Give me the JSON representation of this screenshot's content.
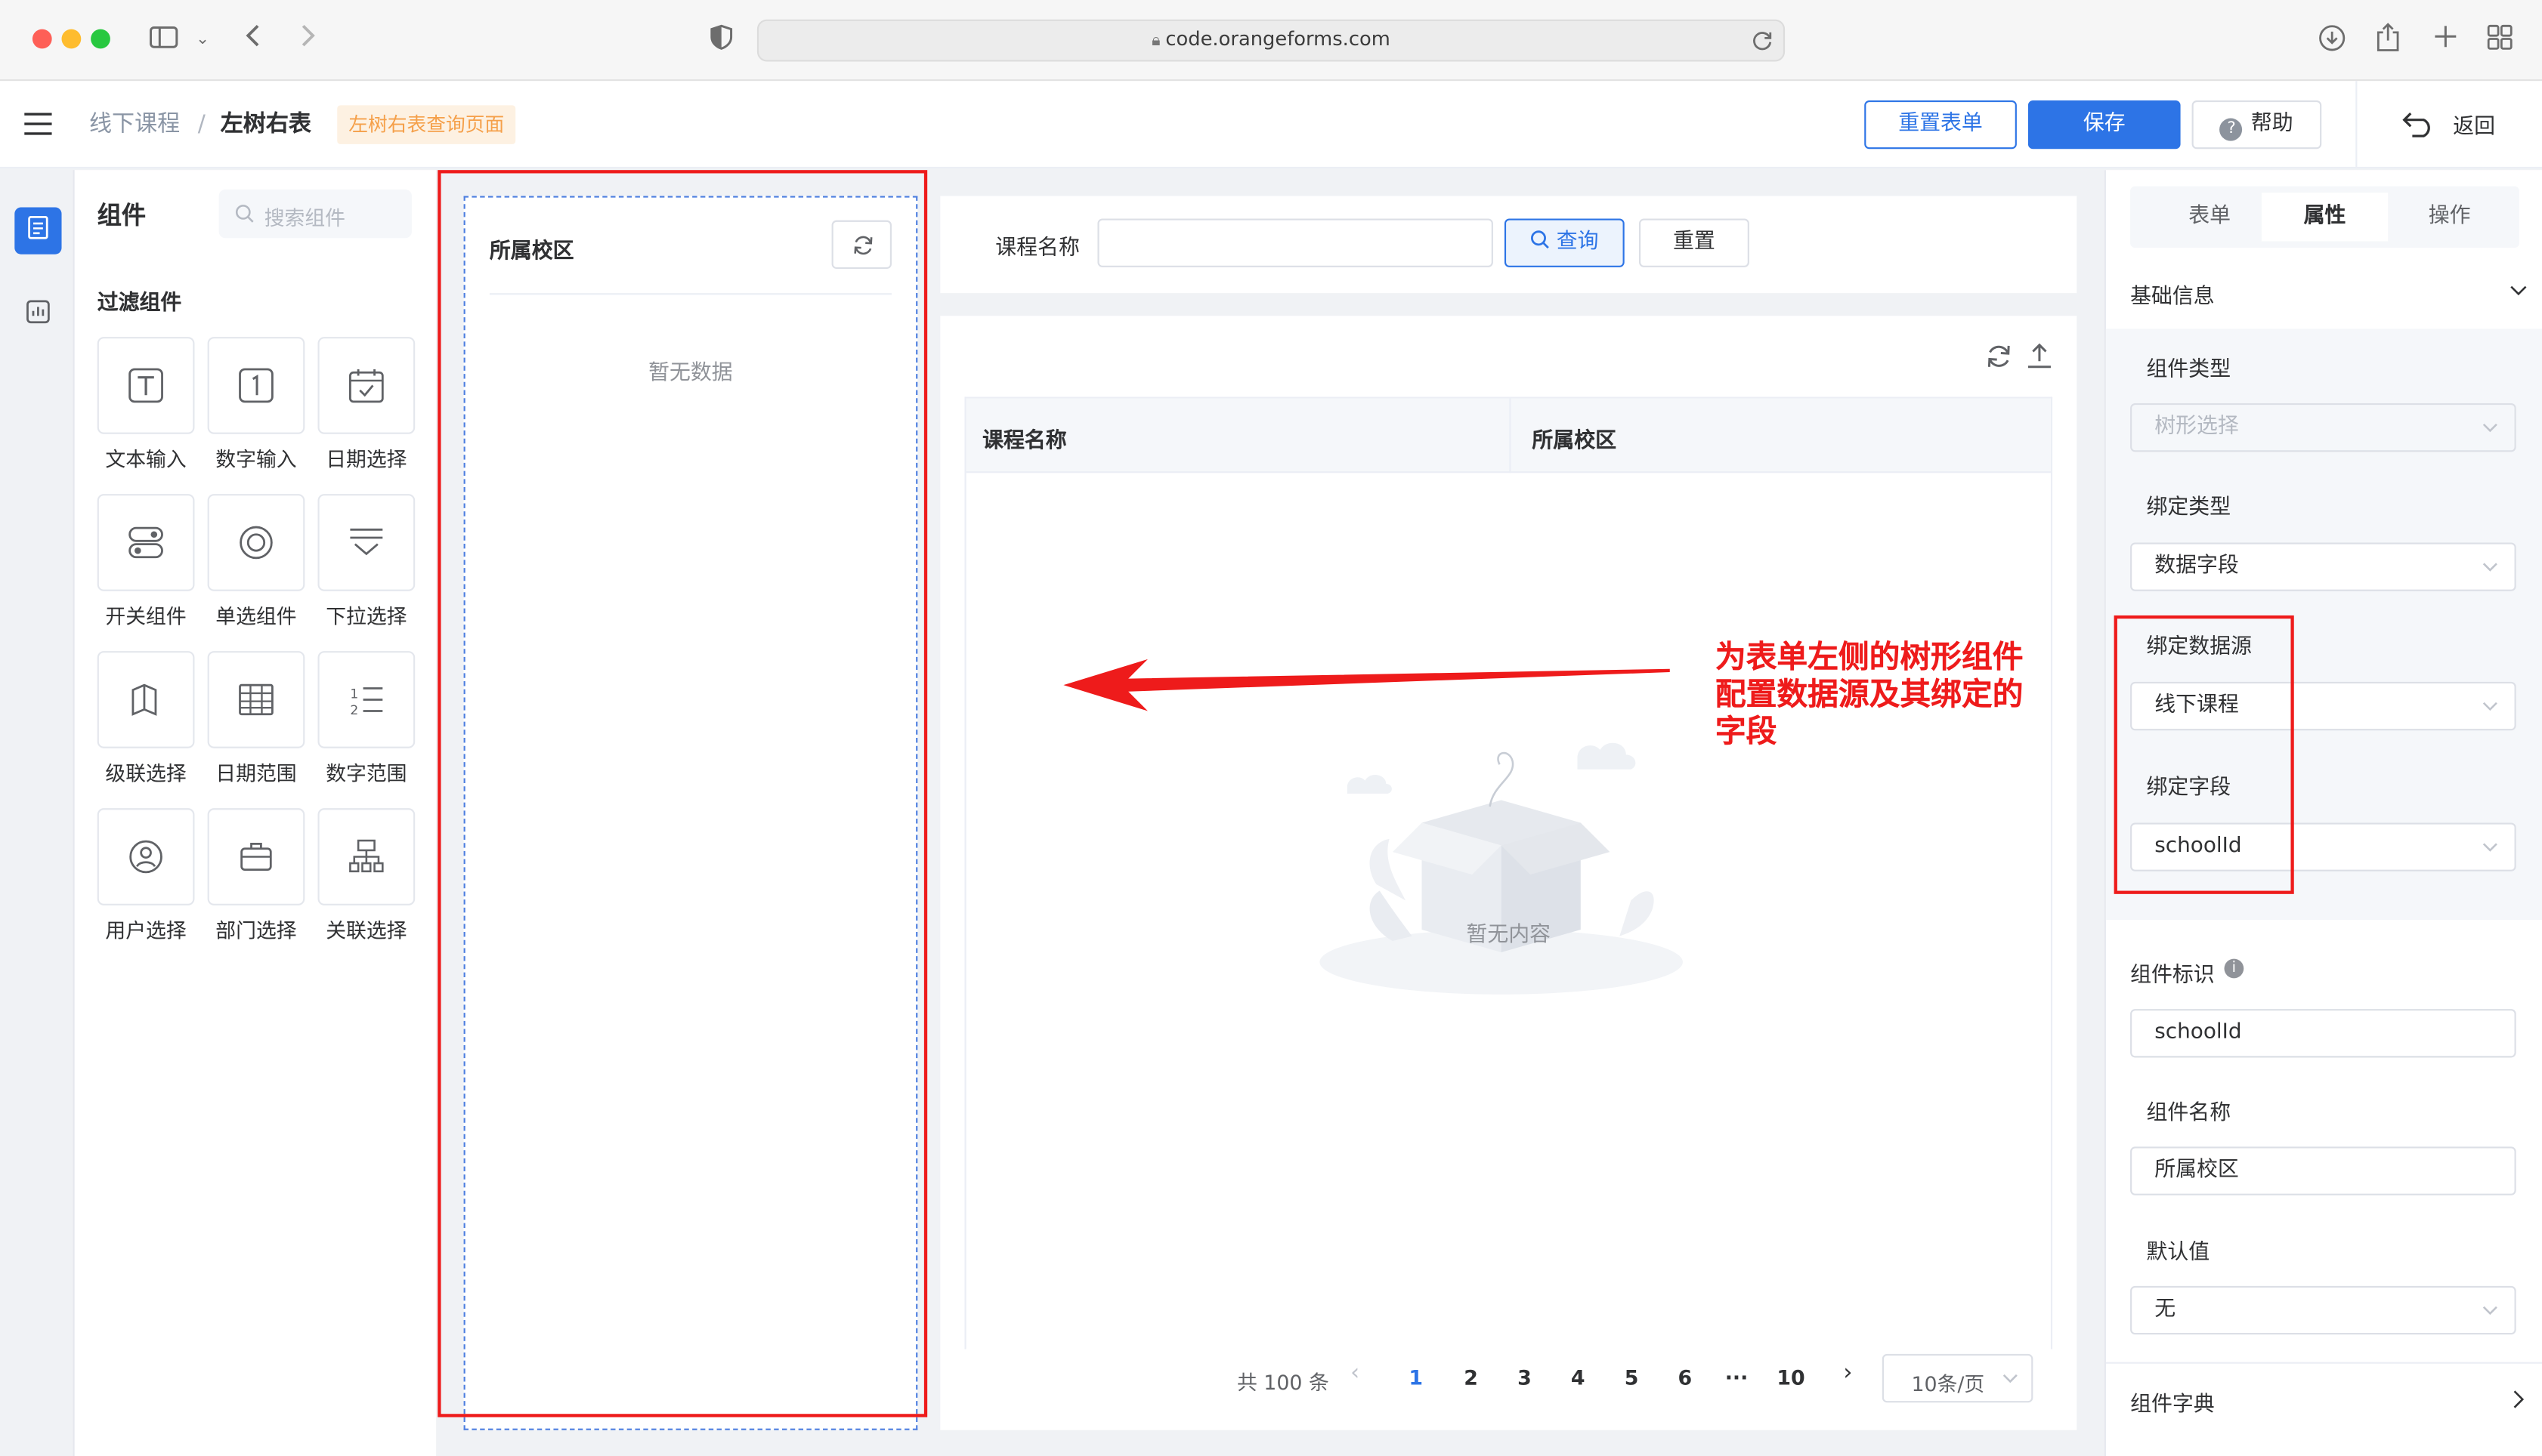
{
  "browser": {
    "url": "code.orangeforms.com"
  },
  "header": {
    "breadcrumb_root": "线下课程",
    "breadcrumb_sep": "/",
    "breadcrumb_current": "左树右表",
    "page_tag": "左树右表查询页面",
    "reset_form_label": "重置表单",
    "save_label": "保存",
    "help_label": "帮助",
    "back_label": "返回"
  },
  "widget_panel": {
    "title": "组件",
    "search_placeholder": "搜索组件",
    "section_title": "过滤组件",
    "items": [
      {
        "label": "文本输入",
        "icon": "text-input-icon"
      },
      {
        "label": "数字输入",
        "icon": "number-input-icon"
      },
      {
        "label": "日期选择",
        "icon": "date-picker-icon"
      },
      {
        "label": "开关组件",
        "icon": "switch-icon"
      },
      {
        "label": "单选组件",
        "icon": "radio-icon"
      },
      {
        "label": "下拉选择",
        "icon": "dropdown-icon"
      },
      {
        "label": "级联选择",
        "icon": "cascader-icon"
      },
      {
        "label": "日期范围",
        "icon": "date-range-icon"
      },
      {
        "label": "数字范围",
        "icon": "number-range-icon"
      },
      {
        "label": "用户选择",
        "icon": "user-select-icon"
      },
      {
        "label": "部门选择",
        "icon": "department-icon"
      },
      {
        "label": "关联选择",
        "icon": "relation-select-icon"
      }
    ]
  },
  "tree_panel": {
    "title": "所属校区",
    "empty_text": "暂无数据"
  },
  "filter_bar": {
    "field_label": "课程名称",
    "field_value": "",
    "search_label": "查询",
    "reset_label": "重置"
  },
  "table": {
    "columns": [
      "课程名称",
      "所属校区"
    ],
    "empty_text": "暂无内容"
  },
  "pagination": {
    "total_text": "共 100 条",
    "pages": [
      "1",
      "2",
      "3",
      "4",
      "5",
      "6",
      "···",
      "10"
    ],
    "current_page": "1",
    "page_size": "10条/页"
  },
  "annotation": {
    "text_line1": "为表单左侧的树形组件",
    "text_line2": "配置数据源及其绑定的",
    "text_line3": "字段",
    "color": "#ee1b1b"
  },
  "properties": {
    "tabs": [
      "表单",
      "属性",
      "操作"
    ],
    "active_tab": "属性",
    "section_basic": "基础信息",
    "component_type_label": "组件类型",
    "component_type_value": "树形选择",
    "bind_type_label": "绑定类型",
    "bind_type_value": "数据字段",
    "bind_datasource_label": "绑定数据源",
    "bind_datasource_value": "线下课程",
    "bind_field_label": "绑定字段",
    "bind_field_value": "schoolId",
    "component_id_label": "组件标识",
    "component_id_value": "schoolId",
    "component_name_label": "组件名称",
    "component_name_value": "所属校区",
    "default_value_label": "默认值",
    "default_value_value": "无",
    "dict_label": "组件字典"
  },
  "colors": {
    "primary": "#2d74e6",
    "tag_text": "#f5a04a",
    "tag_bg": "#fdf1e2",
    "annotation": "#ee1b1b"
  }
}
